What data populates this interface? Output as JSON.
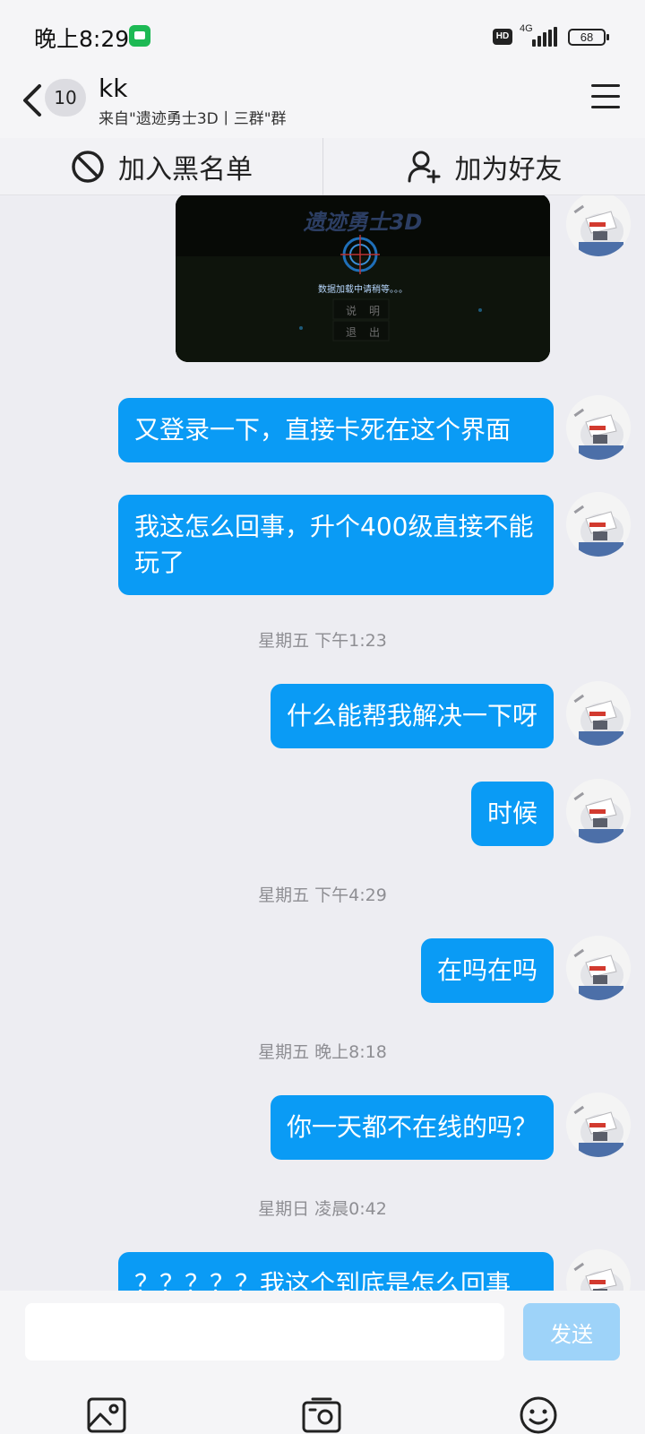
{
  "status_bar": {
    "time": "晚上8:29",
    "hd_label": "HD",
    "network_label": "4G",
    "battery_level": "68"
  },
  "header": {
    "unread_count": "10",
    "chat_name": "kk",
    "subtitle": "来自\"遗迹勇士3D丨三群\"群"
  },
  "actions": {
    "blacklist_label": "加入黑名单",
    "add_friend_label": "加为好友"
  },
  "image_message": {
    "game_title": "遗迹勇士3D",
    "loading_text": "数据加载中请稍等。。。",
    "menu_items": [
      "说明",
      "退出"
    ]
  },
  "messages": [
    {
      "text": "又登录一下，直接卡死在这个界面"
    },
    {
      "text": "我这怎么回事，升个400级直接不能玩了"
    },
    {
      "text": "什么能帮我解决一下呀"
    },
    {
      "text": "时候"
    },
    {
      "text": "在吗在吗"
    },
    {
      "text": "你一天都不在线的吗？"
    },
    {
      "text": "？？？？？我这个到底是怎么回事"
    }
  ],
  "timestamps": [
    "星期五 下午1:23",
    "星期五 下午4:29",
    "星期五 晚上8:18",
    "星期日 凌晨0:42"
  ],
  "input": {
    "placeholder": "",
    "send_label": "发送"
  },
  "icons": {
    "back": "chevron-left-icon",
    "menu": "hamburger-icon",
    "blacklist": "block-icon",
    "add_friend": "add-user-icon",
    "image": "image-icon",
    "camera": "camera-icon",
    "emoji": "emoji-icon"
  },
  "colors": {
    "bubble": "#0A9BF5",
    "send_button": "#9ED3F9",
    "background": "#EDEDF2"
  }
}
